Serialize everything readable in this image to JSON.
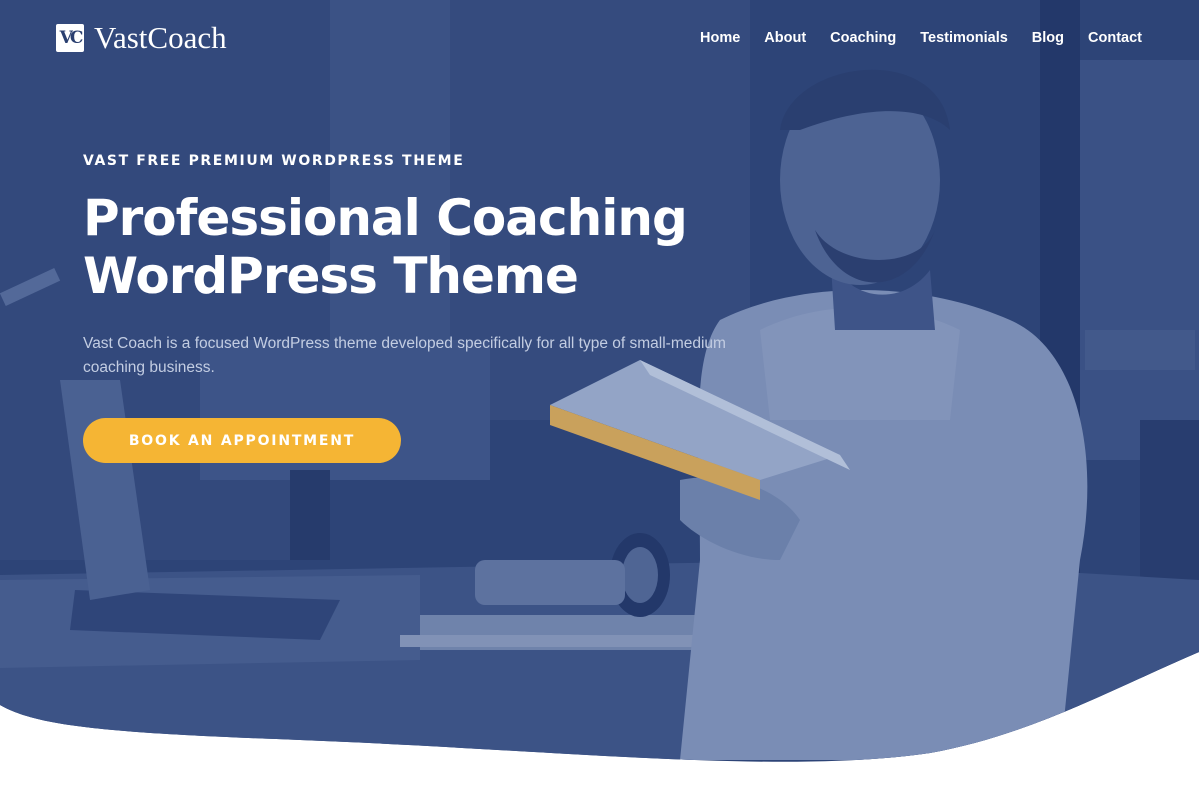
{
  "brand": {
    "logo_mark": "VC",
    "name": "VastCoach"
  },
  "nav": {
    "items": [
      {
        "label": "Home"
      },
      {
        "label": "About"
      },
      {
        "label": "Coaching"
      },
      {
        "label": "Testimonials"
      },
      {
        "label": "Blog"
      },
      {
        "label": "Contact"
      }
    ]
  },
  "hero": {
    "kicker": "VAST FREE PREMIUM WORDPRESS THEME",
    "title_line1": "Professional Coaching",
    "title_line2": "WordPress Theme",
    "description": "Vast Coach is a focused WordPress theme developed specifically for all type of small-medium coaching business.",
    "cta_label": "BOOK AN APPOINTMENT"
  },
  "colors": {
    "overlay": "#2d4477",
    "accent": "#f5b534",
    "text_light": "#c3cde2",
    "background": "#ffffff"
  }
}
